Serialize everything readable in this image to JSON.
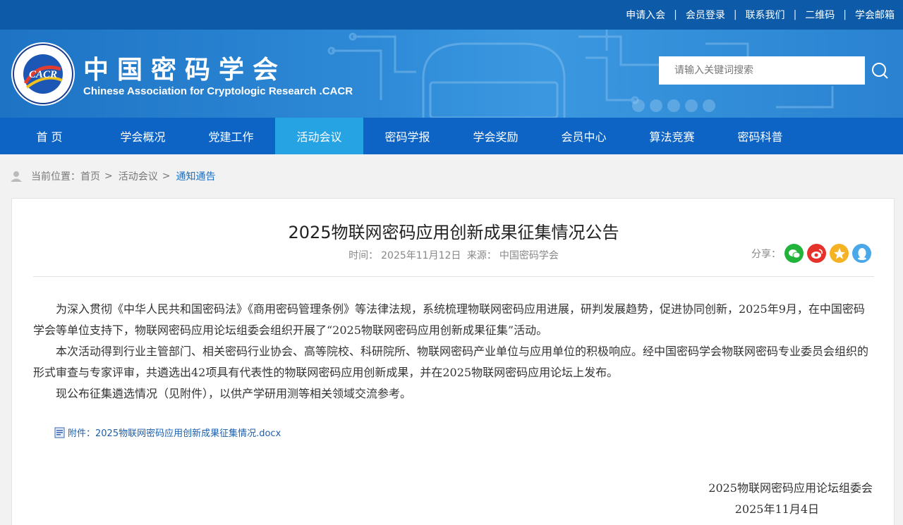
{
  "toplinks": [
    "申请入会",
    "会员登录",
    "联系我们",
    "二维码",
    "学会邮箱"
  ],
  "topsep": "|",
  "site": {
    "title": "中国密码学会",
    "subtitle": "Chinese Association for Cryptologic Research .CACR",
    "logo_text": "CACR",
    "search_placeholder": "请输入关键词搜索",
    "brand_color": "#0d5ba8"
  },
  "nav": [
    {
      "label": "首 页"
    },
    {
      "label": "学会概况"
    },
    {
      "label": "党建工作"
    },
    {
      "label": "活动会议",
      "active": true
    },
    {
      "label": "密码学报"
    },
    {
      "label": "学会奖励"
    },
    {
      "label": "会员中心"
    },
    {
      "label": "算法竞赛"
    },
    {
      "label": "密码科普"
    }
  ],
  "breadcrumb": {
    "prefix": "当前位置：",
    "items": [
      "首页",
      "活动会议"
    ],
    "gt": ">",
    "current": "通知通告"
  },
  "article": {
    "title": "2025物联网密码应用创新成果征集情况公告",
    "time_label": "时间：",
    "time": "2025年11月12日",
    "source_label": "来源：",
    "source": "中国密码学会",
    "share_label": "分享：",
    "share_icons": [
      "wechat-icon",
      "weibo-icon",
      "qzone-icon",
      "qq-icon"
    ],
    "paragraphs": [
      "为深入贯彻《中华人民共和国密码法》《商用密码管理条例》等法律法规，系统梳理物联网密码应用进展，研判发展趋势，促进协同创新，2025年9月，在中国密码学会等单位支持下，物联网密码应用论坛组委会组织开展了“2025物联网密码应用创新成果征集”活动。",
      "本次活动得到行业主管部门、相关密码行业协会、高等院校、科研院所、物联网密码产业单位与应用单位的积极响应。经中国密码学会物联网密码专业委员会组织的形式审查与专家评审，共遴选出42项具有代表性的物联网密码应用创新成果，并在2025物联网密码应用论坛上发布。",
      "现公布征集遴选情况（见附件），以供产学研用测等相关领域交流参考。"
    ],
    "attachment": "附件：2025物联网密码应用创新成果征集情况.docx",
    "signature": "2025物联网密码应用论坛组委会",
    "sign_date": "2025年11月4日"
  }
}
